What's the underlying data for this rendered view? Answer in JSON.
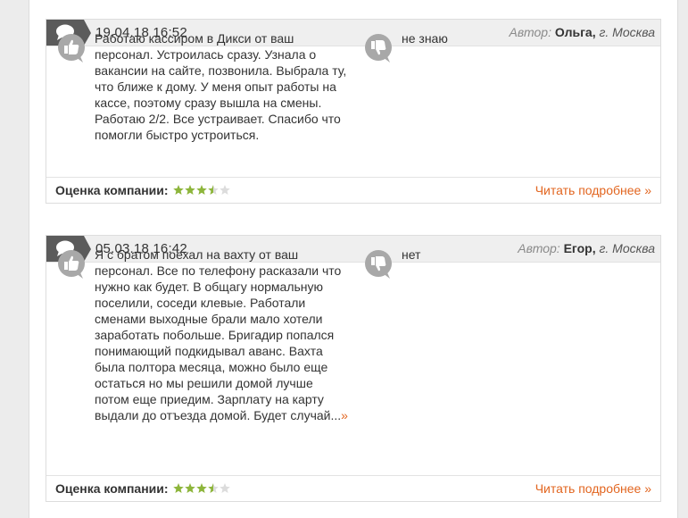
{
  "reviews": [
    {
      "date": "19.04.18 16:52",
      "author_label": "Автор:",
      "author_name": "Ольга",
      "author_city": "г. Москва",
      "positive": "Работаю кассиром в Дикси от ваш персонал. Устроилась сразу. Узнала о вакансии на сайте, позвонила. Выбрала ту, что ближе к дому. У меня опыт работы на кассе, поэтому сразу вышла на смены. Работаю 2/2. Все устраивает. Спасибо что помогли быстро устроиться.",
      "negative": "не знаю",
      "more_marker": "",
      "rating_label": "Оценка компании:",
      "rating": 3.5,
      "read_more": "Читать подробнее »"
    },
    {
      "date": "05.03.18 16:42",
      "author_label": "Автор:",
      "author_name": "Егор",
      "author_city": "г. Москва",
      "positive": "Я с братом поехал на вахту от ваш персонал. Все по телефону расказали что нужно как будет. В общагу нормальную поселили, соседи клевые. Работали сменами выходные брали мало хотели заработать побольше. Бригадир попался понимающий подкидывал аванс. Вахта была полтора месяца, можно было еще остаться но мы решили домой лучше потом еще приедим. Зарплату на карту выдали до отъезда домой. Будет случай...",
      "negative": "нет",
      "more_marker": "»",
      "rating_label": "Оценка компании:",
      "rating": 3.5,
      "read_more": "Читать подробнее »"
    }
  ],
  "colors": {
    "accent": "#e2651f",
    "star_filled": "#8db53b",
    "star_empty": "#dcdcdc",
    "header_bg": "#efefef",
    "icon_dark": "#5b5b5b",
    "thumb_gray": "#a8a8a8"
  },
  "icons": {
    "header": "speech-bubble-icon",
    "positive": "thumbs-up-icon",
    "negative": "thumbs-down-icon",
    "rating": "star-icon"
  }
}
